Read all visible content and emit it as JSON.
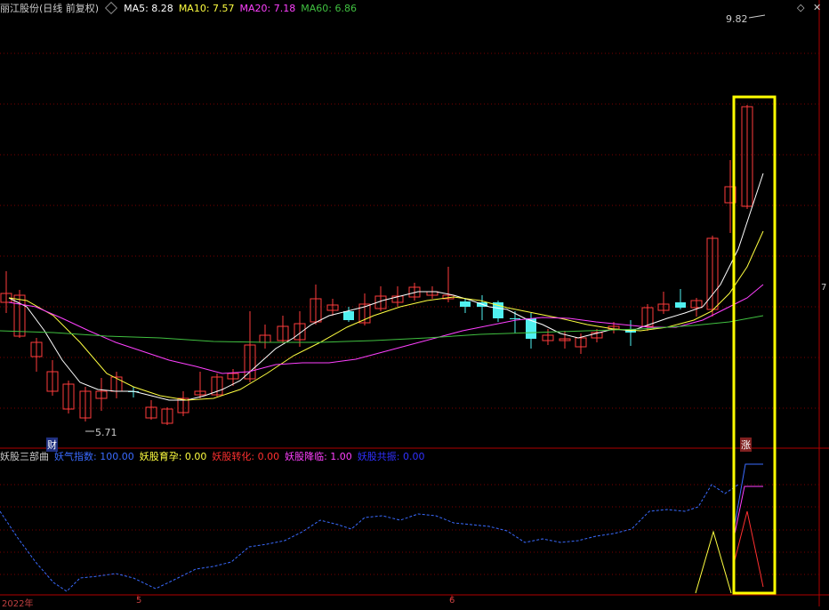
{
  "header": {
    "stock_title": "丽江股份(日线 前复权)",
    "ma": [
      {
        "label": "MA5: 8.28",
        "color": "#ffffff"
      },
      {
        "label": "MA10: 7.57",
        "color": "#ffff40"
      },
      {
        "label": "MA20: 7.18",
        "color": "#ff40ff"
      },
      {
        "label": "MA60: 6.86",
        "color": "#40c040"
      }
    ],
    "high_marker": "9.82",
    "low_marker": "5.71",
    "right_price_tag": "7"
  },
  "tags": {
    "cai": "财",
    "zhang": "涨"
  },
  "indicator": {
    "name": "妖股三部曲",
    "items": [
      {
        "label": "妖气指数: 100.00",
        "color": "#3a6bff"
      },
      {
        "label": "妖股育孕: 0.00",
        "color": "#ffff40"
      },
      {
        "label": "妖股转化: 0.00",
        "color": "#ff3030"
      },
      {
        "label": "妖股降临: 1.00",
        "color": "#ff40ff"
      },
      {
        "label": "妖股共振: 0.00",
        "color": "#3030ff"
      }
    ]
  },
  "time_axis": {
    "labels": [
      "2022年",
      "5",
      "6"
    ]
  },
  "colors": {
    "up": "#ff3c3c",
    "down": "#50f0f0",
    "grid": "#7a0000",
    "highlight": "#ffff00"
  },
  "icons": {
    "settings": "diamond-icon",
    "close": "close-icon"
  }
}
